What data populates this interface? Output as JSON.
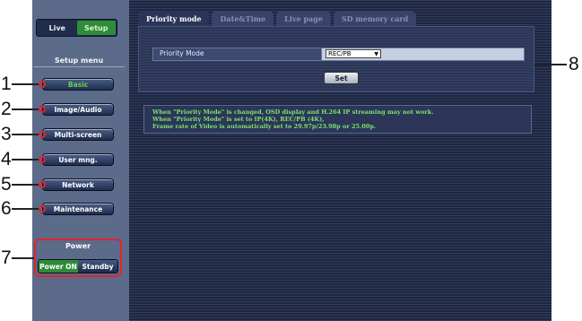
{
  "top_tabs": {
    "live": "Live",
    "setup": "Setup"
  },
  "sidebar": {
    "title": "Setup menu",
    "items": [
      {
        "label": "Basic",
        "selected": true
      },
      {
        "label": "Image/Audio"
      },
      {
        "label": "Multi-screen"
      },
      {
        "label": "User mng."
      },
      {
        "label": "Network"
      },
      {
        "label": "Maintenance"
      }
    ]
  },
  "power": {
    "title": "Power",
    "on_label": "Power ON",
    "standby_label": "Standby"
  },
  "tabs": [
    {
      "label": "Priority mode",
      "active": true
    },
    {
      "label": "Date&Time"
    },
    {
      "label": "Live page"
    },
    {
      "label": "SD memory card"
    }
  ],
  "priority": {
    "label": "Priority Mode",
    "value": "REC/PB",
    "set_label": "Set"
  },
  "notice": [
    "When \"Priority Mode\" is changed, OSD display and H.264 IP streaming may not work.",
    "When \"Priority Mode\" is set to IP(4K), REC/PB (4K),",
    "Frame rate of Video is automatically set to 29.97p/23.98p or 25.00p."
  ],
  "callouts": [
    "1",
    "2",
    "3",
    "4",
    "5",
    "6",
    "7",
    "8"
  ],
  "colors": {
    "accent_green": "#2f8d3a",
    "highlight_red": "#e3232c",
    "notice_text": "#7ee36a"
  }
}
